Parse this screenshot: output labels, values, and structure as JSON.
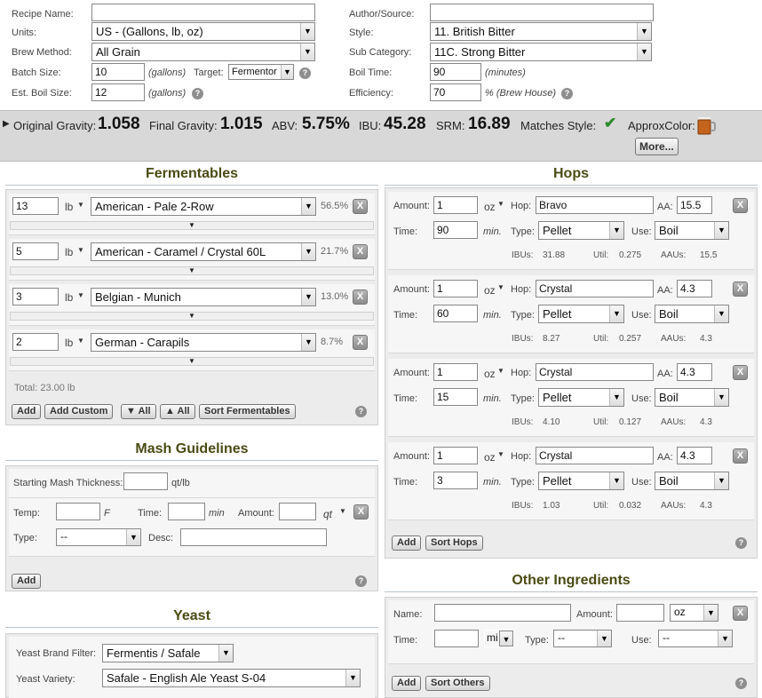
{
  "top": {
    "recipe_name_label": "Recipe Name:",
    "recipe_name_value": "",
    "units_label": "Units:",
    "units_value": "US - (Gallons, lb, oz)",
    "brew_method_label": "Brew Method:",
    "brew_method_value": "All Grain",
    "batch_size_label": "Batch Size:",
    "batch_size_value": "10",
    "batch_size_unit": "(gallons)",
    "target_label": "Target:",
    "target_value": "Fermentor",
    "boil_size_label": "Est. Boil Size:",
    "boil_size_value": "12",
    "boil_size_unit": "(gallons)",
    "author_label": "Author/Source:",
    "author_value": "",
    "style_label": "Style:",
    "style_value": "11. British Bitter",
    "subcat_label": "Sub Category:",
    "subcat_value": "11C. Strong Bitter",
    "boil_time_label": "Boil Time:",
    "boil_time_value": "90",
    "boil_time_unit": "(minutes)",
    "efficiency_label": "Efficiency:",
    "efficiency_value": "70",
    "efficiency_unit": "% (Brew House)"
  },
  "stats": {
    "og_label": "Original Gravity:",
    "og_value": "1.058",
    "fg_label": "Final Gravity:",
    "fg_value": "1.015",
    "abv_label": "ABV:",
    "abv_value": "5.75%",
    "ibu_label": "IBU:",
    "ibu_value": "45.28",
    "srm_label": "SRM:",
    "srm_value": "16.89",
    "matches_label": "Matches Style:",
    "color_label": "ApproxColor:",
    "more_button": "More..."
  },
  "fermentables": {
    "title": "Fermentables",
    "items": [
      {
        "amount": "13",
        "unit": "lb",
        "name": "American - Pale 2-Row",
        "pct": "56.5%"
      },
      {
        "amount": "5",
        "unit": "lb",
        "name": "American - Caramel / Crystal 60L",
        "pct": "21.7%"
      },
      {
        "amount": "3",
        "unit": "lb",
        "name": "Belgian - Munich",
        "pct": "13.0%"
      },
      {
        "amount": "2",
        "unit": "lb",
        "name": "German - Carapils",
        "pct": "8.7%"
      }
    ],
    "total": "Total: 23.00 lb",
    "add": "Add",
    "add_custom": "Add Custom",
    "down_all": "▼ All",
    "up_all": "▲ All",
    "sort": "Sort Fermentables"
  },
  "mash": {
    "title": "Mash Guidelines",
    "thickness_label": "Starting Mash Thickness:",
    "thickness_unit": "qt/lb",
    "temp_label": "Temp:",
    "temp_unit": "F",
    "time_label": "Time:",
    "time_unit": "min",
    "amount_label": "Amount:",
    "amount_unit": "qt",
    "type_label": "Type:",
    "type_value": "--",
    "desc_label": "Desc:",
    "add": "Add"
  },
  "yeast": {
    "title": "Yeast",
    "brand_label": "Yeast Brand Filter:",
    "brand_value": "Fermentis / Safale",
    "variety_label": "Yeast Variety:",
    "variety_value": "Safale - English Ale Yeast S-04"
  },
  "hops": {
    "title": "Hops",
    "amount_label": "Amount:",
    "hop_label": "Hop:",
    "aa_label": "AA:",
    "time_label": "Time:",
    "type_label": "Type:",
    "use_label": "Use:",
    "ibus_label": "IBUs:",
    "util_label": "Util:",
    "aaus_label": "AAUs:",
    "unit": "oz",
    "min": "min.",
    "items": [
      {
        "amount": "1",
        "name": "Bravo",
        "aa": "15.5",
        "time": "90",
        "type": "Pellet",
        "use": "Boil",
        "ibus": "31.88",
        "util": "0.275",
        "aaus": "15.5"
      },
      {
        "amount": "1",
        "name": "Crystal",
        "aa": "4.3",
        "time": "60",
        "type": "Pellet",
        "use": "Boil",
        "ibus": "8.27",
        "util": "0.257",
        "aaus": "4.3"
      },
      {
        "amount": "1",
        "name": "Crystal",
        "aa": "4.3",
        "time": "15",
        "type": "Pellet",
        "use": "Boil",
        "ibus": "4.10",
        "util": "0.127",
        "aaus": "4.3"
      },
      {
        "amount": "1",
        "name": "Crystal",
        "aa": "4.3",
        "time": "3",
        "type": "Pellet",
        "use": "Boil",
        "ibus": "1.03",
        "util": "0.032",
        "aaus": "4.3"
      }
    ],
    "add": "Add",
    "sort": "Sort Hops"
  },
  "other": {
    "title": "Other Ingredients",
    "name_label": "Name:",
    "amount_label": "Amount:",
    "amount_unit": "oz",
    "time_label": "Time:",
    "time_unit": "mi",
    "type_label": "Type:",
    "type_value": "--",
    "use_label": "Use:",
    "use_value": "--",
    "add": "Add",
    "sort": "Sort Others"
  },
  "glyphs": {
    "x": "X",
    "help": "?",
    "arrow": "▼",
    "check": "✔",
    "tri": "▶"
  }
}
